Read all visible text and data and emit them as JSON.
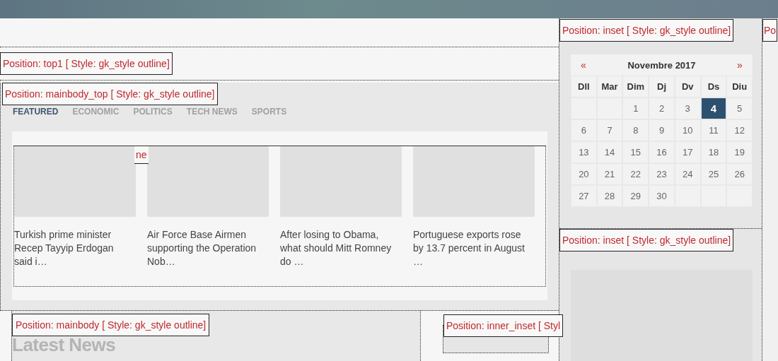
{
  "positions": {
    "top1": "Position: top1 [ Style: gk_style outline]",
    "mainbody_top": "Position: mainbody_top [ Style: gk_style outline]",
    "fragment": "ne",
    "mainbody": "Position: mainbody [ Style: gk_style outline]",
    "inner_inset": "Position: inner_inset [ Styl",
    "inset_1": "Position: inset [ Style: gk_style outline]",
    "inset_2": "Position: inset [ Style: gk_style outline]",
    "edge": "Po"
  },
  "tabs": [
    {
      "label": "FEATURED",
      "selected": true
    },
    {
      "label": "ECONOMIC",
      "selected": false
    },
    {
      "label": "POLITICS",
      "selected": false
    },
    {
      "label": "TECH NEWS",
      "selected": false
    },
    {
      "label": "SPORTS",
      "selected": false
    }
  ],
  "articles": [
    {
      "title": "Turkish prime minister Recep Tayyip Erdogan said i…"
    },
    {
      "title": "Air Force Base Airmen supporting the Operation Nob…"
    },
    {
      "title": "After losing to Obama, what should Mitt Romney do …"
    },
    {
      "title": "Portuguese exports rose by 13.7 percent in August …"
    }
  ],
  "latest_heading": "Latest News",
  "calendar": {
    "prev": "«",
    "title": "Novembre 2017",
    "next": "»",
    "weekdays": [
      "Dll",
      "Mar",
      "Dim",
      "Dj",
      "Dv",
      "Ds",
      "Diu"
    ],
    "weeks": [
      [
        {
          "kind": "blank"
        },
        {
          "kind": "blank"
        },
        {
          "kind": "day",
          "day": "1",
          "selected": false
        },
        {
          "day": "2",
          "selected": false
        },
        {
          "day": "3",
          "selected": false
        },
        {
          "day": "4",
          "selected": true
        },
        {
          "day": "5",
          "selected": false
        }
      ],
      [
        {
          "day": "6",
          "selected": false
        },
        {
          "day": "7",
          "selected": false
        },
        {
          "day": "8",
          "selected": false
        },
        {
          "day": "9",
          "selected": false
        },
        {
          "day": "10",
          "selected": false
        },
        {
          "day": "11",
          "selected": false
        },
        {
          "day": "12",
          "selected": false
        }
      ],
      [
        {
          "day": "13",
          "selected": false
        },
        {
          "day": "14",
          "selected": false
        },
        {
          "day": "15",
          "selected": false
        },
        {
          "day": "16",
          "selected": false
        },
        {
          "day": "17",
          "selected": false
        },
        {
          "day": "18",
          "selected": false
        },
        {
          "day": "19",
          "selected": false
        }
      ],
      [
        {
          "day": "20",
          "selected": false
        },
        {
          "day": "21",
          "selected": false
        },
        {
          "day": "22",
          "selected": false
        },
        {
          "day": "23",
          "selected": false
        },
        {
          "day": "24",
          "selected": false
        },
        {
          "day": "25",
          "selected": false
        },
        {
          "day": "26",
          "selected": false
        }
      ],
      [
        {
          "day": "27",
          "selected": false
        },
        {
          "day": "28",
          "selected": false
        },
        {
          "day": "29",
          "selected": false
        },
        {
          "day": "30",
          "selected": false
        },
        {
          "kind": "blank"
        },
        {
          "kind": "blank"
        },
        {
          "kind": "blank"
        }
      ]
    ]
  }
}
